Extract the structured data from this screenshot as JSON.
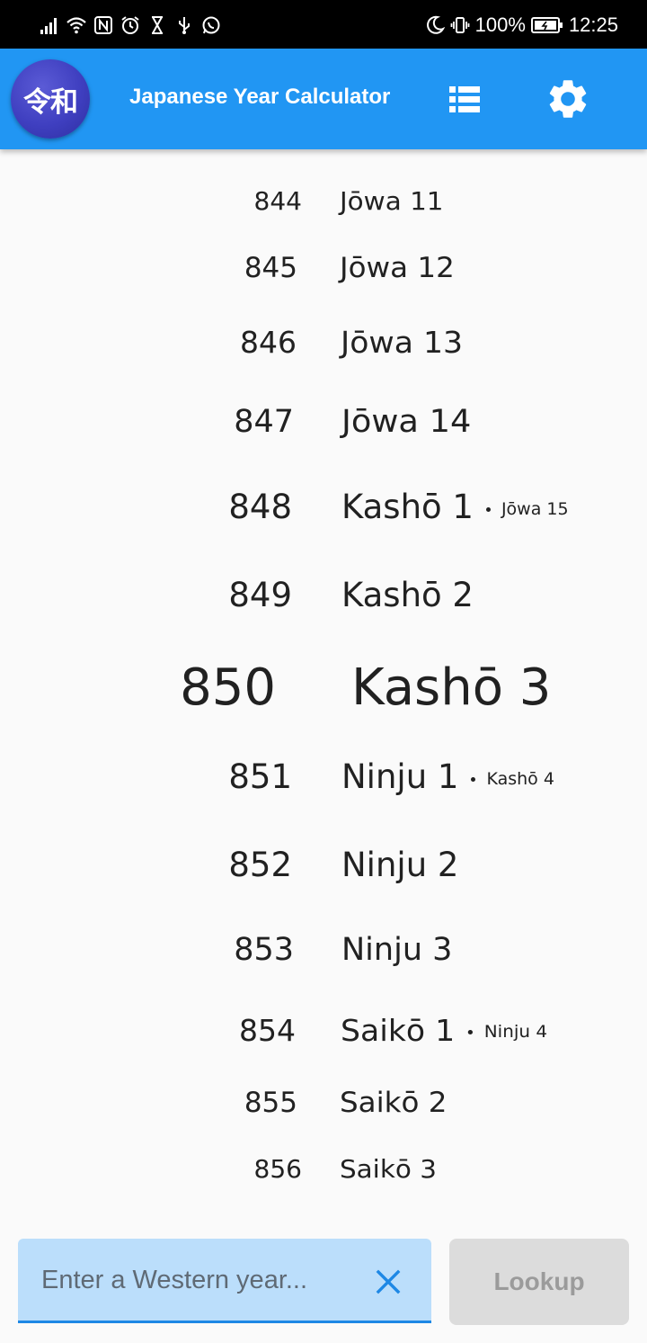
{
  "status_bar": {
    "battery": "100%",
    "time": "12:25"
  },
  "app_bar": {
    "logo_text": "令和",
    "title": "Japanese Year Calculator"
  },
  "years": [
    {
      "year": "844",
      "era": "Jōwa 11",
      "alt": ""
    },
    {
      "year": "845",
      "era": "Jōwa 12",
      "alt": ""
    },
    {
      "year": "846",
      "era": "Jōwa 13",
      "alt": ""
    },
    {
      "year": "847",
      "era": "Jōwa 14",
      "alt": ""
    },
    {
      "year": "848",
      "era": "Kashō 1",
      "alt": "Jōwa 15"
    },
    {
      "year": "849",
      "era": "Kashō 2",
      "alt": ""
    },
    {
      "year": "850",
      "era": "Kashō 3",
      "alt": ""
    },
    {
      "year": "851",
      "era": "Ninju 1",
      "alt": "Kashō 4"
    },
    {
      "year": "852",
      "era": "Ninju 2",
      "alt": ""
    },
    {
      "year": "853",
      "era": "Ninju 3",
      "alt": ""
    },
    {
      "year": "854",
      "era": "Saikō 1",
      "alt": "Ninju 4"
    },
    {
      "year": "855",
      "era": "Saikō 2",
      "alt": ""
    },
    {
      "year": "856",
      "era": "Saikō 3",
      "alt": ""
    }
  ],
  "input": {
    "placeholder": "Enter a Western year...",
    "value": ""
  },
  "lookup_label": "Lookup",
  "colors": {
    "app_bar": "#2196f3",
    "input_bg": "#bbdefb",
    "accent": "#1e88e5",
    "button_disabled": "#dcdcdc"
  }
}
